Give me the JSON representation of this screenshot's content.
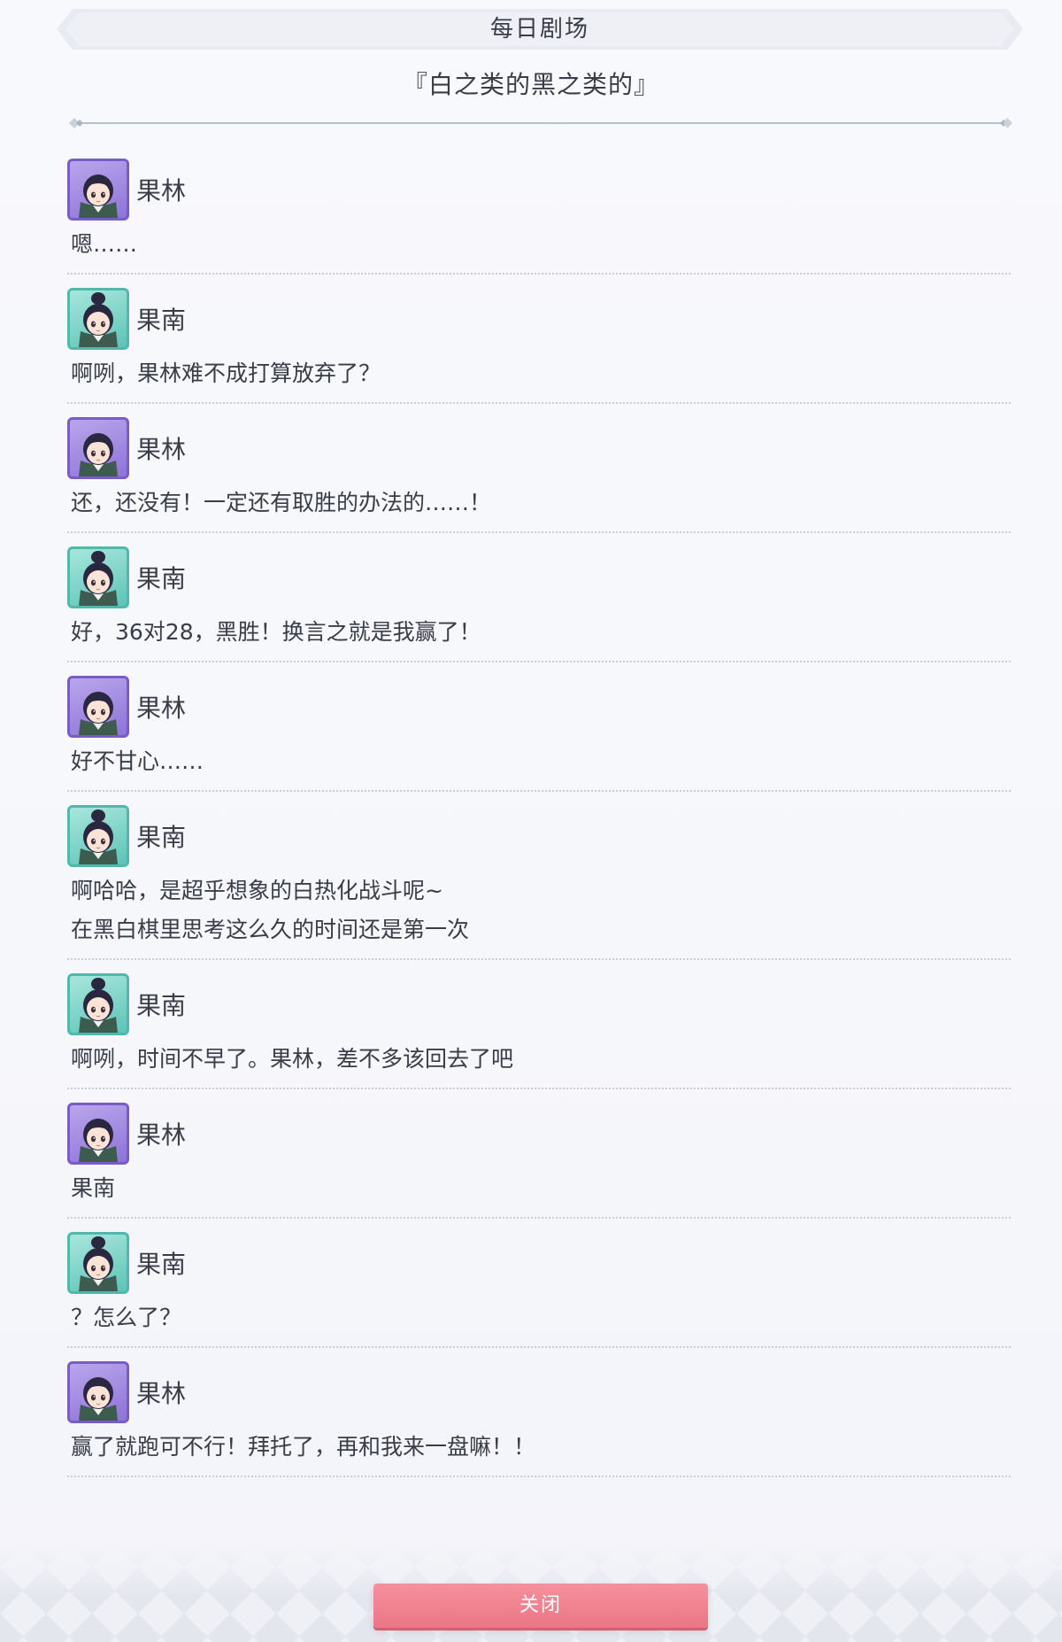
{
  "header": {
    "title": "每日剧场",
    "subtitle": "『白之类的黑之类的』"
  },
  "dialogue": [
    {
      "speaker": "果林",
      "avatar": "purple",
      "lines": [
        "嗯……"
      ]
    },
    {
      "speaker": "果南",
      "avatar": "teal",
      "lines": [
        "啊咧，果林难不成打算放弃了？"
      ]
    },
    {
      "speaker": "果林",
      "avatar": "purple",
      "lines": [
        "还，还没有！一定还有取胜的办法的……！"
      ]
    },
    {
      "speaker": "果南",
      "avatar": "teal",
      "lines": [
        "好，36对28，黑胜！换言之就是我赢了！"
      ]
    },
    {
      "speaker": "果林",
      "avatar": "purple",
      "lines": [
        "好不甘心……"
      ]
    },
    {
      "speaker": "果南",
      "avatar": "teal",
      "lines": [
        "啊哈哈，是超乎想象的白热化战斗呢~",
        "在黑白棋里思考这么久的时间还是第一次"
      ]
    },
    {
      "speaker": "果南",
      "avatar": "teal",
      "lines": [
        "啊咧，时间不早了。果林，差不多该回去了吧"
      ]
    },
    {
      "speaker": "果林",
      "avatar": "purple",
      "lines": [
        "果南"
      ]
    },
    {
      "speaker": "果南",
      "avatar": "teal",
      "lines": [
        "？怎么了？"
      ]
    },
    {
      "speaker": "果林",
      "avatar": "purple",
      "lines": [
        "赢了就跑可不行！拜托了，再和我来一盘嘛！！"
      ]
    }
  ],
  "footer": {
    "close_label": "关闭"
  },
  "colors": {
    "close_button": "#ec7584",
    "karin_frame": "#7a5cc6",
    "kanan_frame": "#4fb9ad"
  },
  "icons": {
    "karin_avatar": "karin-portrait-icon",
    "kanan_avatar": "kanan-portrait-icon"
  }
}
